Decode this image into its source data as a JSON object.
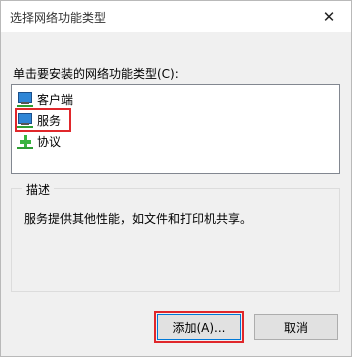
{
  "window": {
    "title": "选择网络功能类型",
    "close_symbol": "✕"
  },
  "prompt": "单击要安装的网络功能类型(C):",
  "list": {
    "items": [
      {
        "label": "客户端",
        "icon": "client-monitor-icon"
      },
      {
        "label": "服务",
        "icon": "service-monitor-icon"
      },
      {
        "label": "协议",
        "icon": "protocol-icon"
      }
    ]
  },
  "description": {
    "label": "描述",
    "text": "服务提供其他性能，如文件和打印机共享。"
  },
  "buttons": {
    "add": "添加(A)...",
    "cancel": "取消"
  },
  "colors": {
    "highlight": "#e0272b",
    "accent": "#0078d7"
  }
}
